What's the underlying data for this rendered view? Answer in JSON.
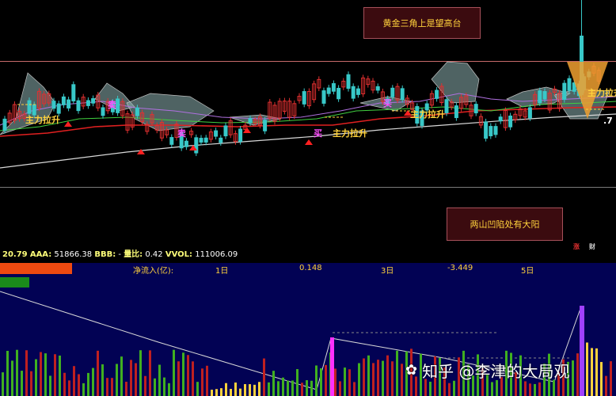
{
  "annotations": {
    "top": "黄金三角上是望高台",
    "bottom": "两山凹陷处有大阳"
  },
  "chart_tags": {
    "pull_up": "主力拉升",
    "buy": "买",
    "sell": "卖",
    "edge_value": ".7"
  },
  "status_bar": {
    "v1": "20.79",
    "aaa_label": "AAA:",
    "aaa_value": "51866.38",
    "bbb_label": "BBB:",
    "bbb_value": "-",
    "ratio_label": "量比:",
    "ratio_value": "0.42",
    "vvol_label": "VVOL:",
    "vvol_value": "111006.09"
  },
  "lower_header": {
    "net_inflow": "净流入(亿):",
    "d1_label": "1日",
    "d1_value": "0.148",
    "d3_label": "3日",
    "d3_value": "-3.449",
    "d5_label": "5日",
    "right_a": "涨",
    "right_b": "财"
  },
  "watermark": {
    "text": "知乎 @李津的大局观"
  },
  "colors": {
    "up": "#e03030",
    "down": "#38c8c8",
    "ma_red": "#e02020",
    "ma_white": "#d8d8d8",
    "band": "#8fb4b4",
    "accent": "#ffd23c"
  }
}
